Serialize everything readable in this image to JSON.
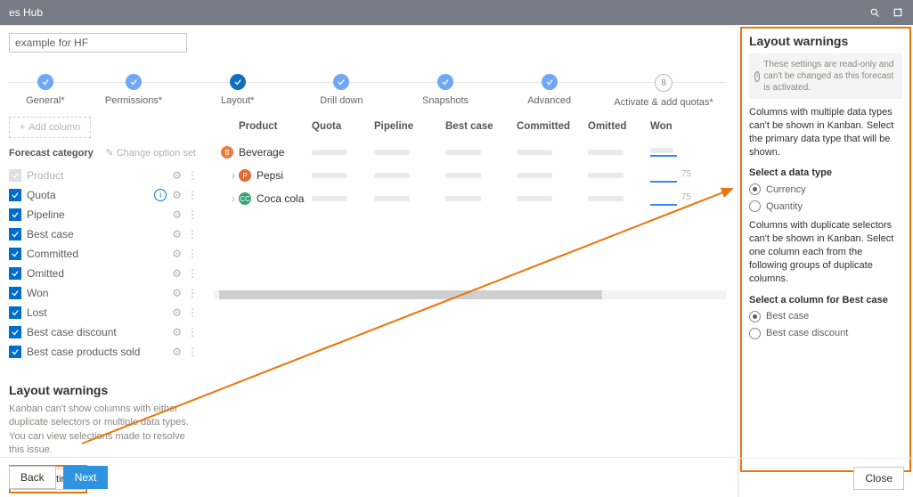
{
  "topbar": {
    "app_title": "es Hub"
  },
  "search_value": "example for HF",
  "stepper": [
    {
      "label": "General*",
      "state": "done"
    },
    {
      "label": "Permissions*",
      "state": "done"
    },
    {
      "label": "Layout*",
      "state": "current"
    },
    {
      "label": "Drill down",
      "state": "done"
    },
    {
      "label": "Snapshots",
      "state": "done"
    },
    {
      "label": "Advanced",
      "state": "done"
    },
    {
      "label": "Activate & add quotas*",
      "state": "pending",
      "num": "8"
    }
  ],
  "add_column_label": "Add column",
  "forecast_category": {
    "title": "Forecast category",
    "change_opt": "Change option set",
    "items": [
      {
        "label": "Product",
        "checked": false,
        "disabled": true
      },
      {
        "label": "Quota",
        "checked": true,
        "info": true
      },
      {
        "label": "Pipeline",
        "checked": true
      },
      {
        "label": "Best case",
        "checked": true
      },
      {
        "label": "Committed",
        "checked": true
      },
      {
        "label": "Omitted",
        "checked": true
      },
      {
        "label": "Won",
        "checked": true
      },
      {
        "label": "Lost",
        "checked": true
      },
      {
        "label": "Best case discount",
        "checked": true
      },
      {
        "label": "Best case products sold",
        "checked": true
      }
    ]
  },
  "layout_warnings": {
    "heading": "Layout warnings",
    "text": "Kanban can't show columns with either duplicate selectors or multiple data types. You can view selections made to resolve this issue.",
    "button": "View settings"
  },
  "preview_table": {
    "headers": [
      "Product",
      "Quota",
      "Pipeline",
      "Best case",
      "Committed",
      "Omitted",
      "Won"
    ],
    "rows": [
      {
        "name": "Beverage",
        "avatar": "B",
        "avatar_class": "av-b",
        "won_num": ""
      },
      {
        "name": "Pepsi",
        "avatar": "P",
        "avatar_class": "av-p",
        "chevron": true,
        "won_num": "75"
      },
      {
        "name": "Coca cola",
        "avatar": "CC",
        "avatar_class": "av-c",
        "chevron": true,
        "won_num": "75"
      }
    ]
  },
  "side_panel": {
    "title": "Layout warnings",
    "info_text": "These settings are read-only and can't be changed as this forecast is activated.",
    "para1": "Columns with multiple data types can't be shown in Kanban. Select the primary data type that will be shown.",
    "group1_title": "Select a data type",
    "radios1": [
      {
        "label": "Currency",
        "selected": true
      },
      {
        "label": "Quantity",
        "selected": false
      }
    ],
    "para2": "Columns with duplicate selectors can't be shown in Kanban. Select one column each from the following groups of duplicate columns.",
    "group2_title": "Select a column for Best case",
    "radios2": [
      {
        "label": "Best case",
        "selected": true
      },
      {
        "label": "Best case discount",
        "selected": false
      }
    ],
    "close_label": "Close"
  },
  "bottom": {
    "back": "Back",
    "next": "Next"
  },
  "colors": {
    "accent": "#e8760b"
  }
}
